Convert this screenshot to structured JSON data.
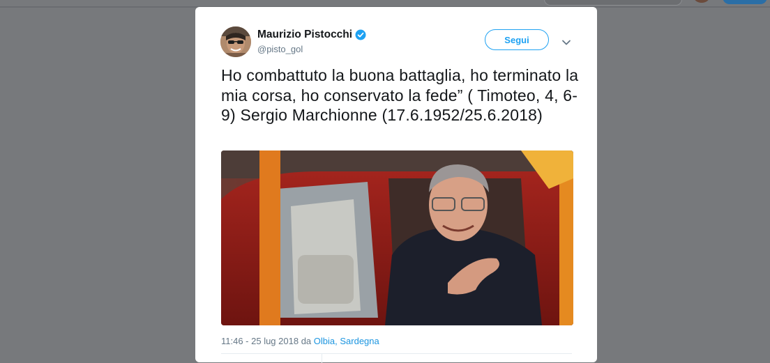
{
  "tweet": {
    "author": {
      "name": "Maurizio Pistocchi",
      "handle": "@pisto_gol",
      "verified": true
    },
    "follow_label": "Segui",
    "text": "Ho combattuto la buona battaglia, ho terminato la mia corsa, ho conservato la fede” ( Timoteo, 4, 6-9)  Sergio Marchionne (17.6.1952/25.6.2018)",
    "timestamp": "11:46 - 25 lug 2018",
    "from_label": "da",
    "location": "Olbia, Sardegna"
  },
  "colors": {
    "backdrop": "#77797c",
    "accent": "#1da1f2",
    "link": "#1b95e0",
    "muted_text": "#657786"
  },
  "icons": {
    "verified": "verified-badge-icon",
    "menu": "chevron-down-icon"
  }
}
